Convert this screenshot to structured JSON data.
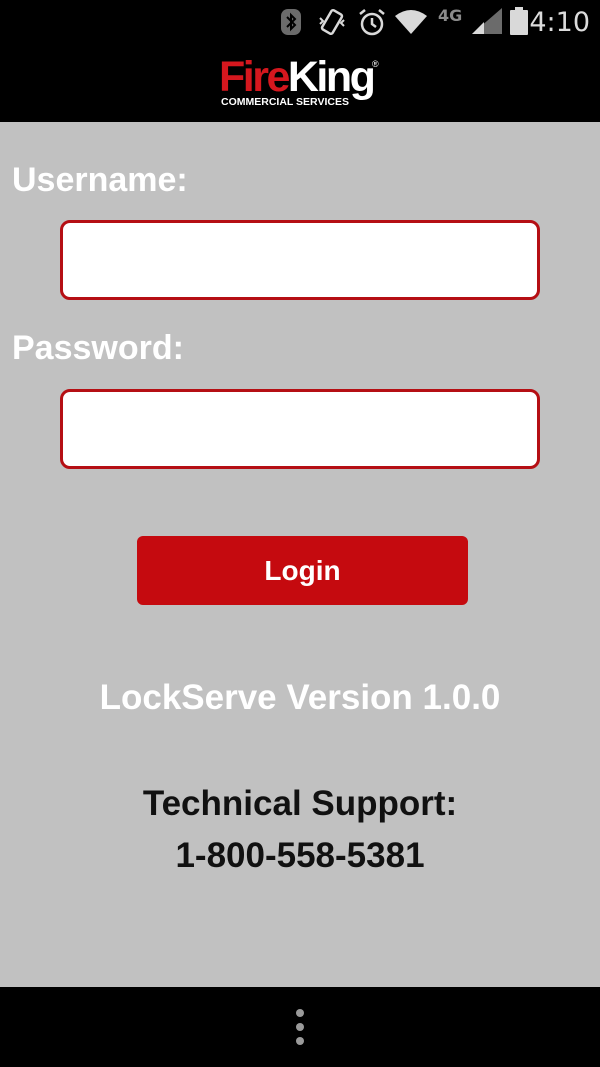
{
  "status_bar": {
    "network_label": "4G",
    "time": "4:10"
  },
  "header": {
    "logo_fire": "Fire",
    "logo_king": "King",
    "logo_reg": "®",
    "logo_subtitle": "COMMERCIAL SERVICES",
    "brand_color": "#d5171e"
  },
  "login_form": {
    "username_label": "Username:",
    "username_value": "",
    "password_label": "Password:",
    "password_value": "",
    "login_label": "Login",
    "accent_color": "#c50a0f"
  },
  "footer_info": {
    "version": "LockServe Version 1.0.0",
    "support_title": "Technical Support:",
    "support_phone": "1-800-558-5381"
  },
  "nav_bar": {
    "menu_icon": "overflow-menu-icon"
  }
}
